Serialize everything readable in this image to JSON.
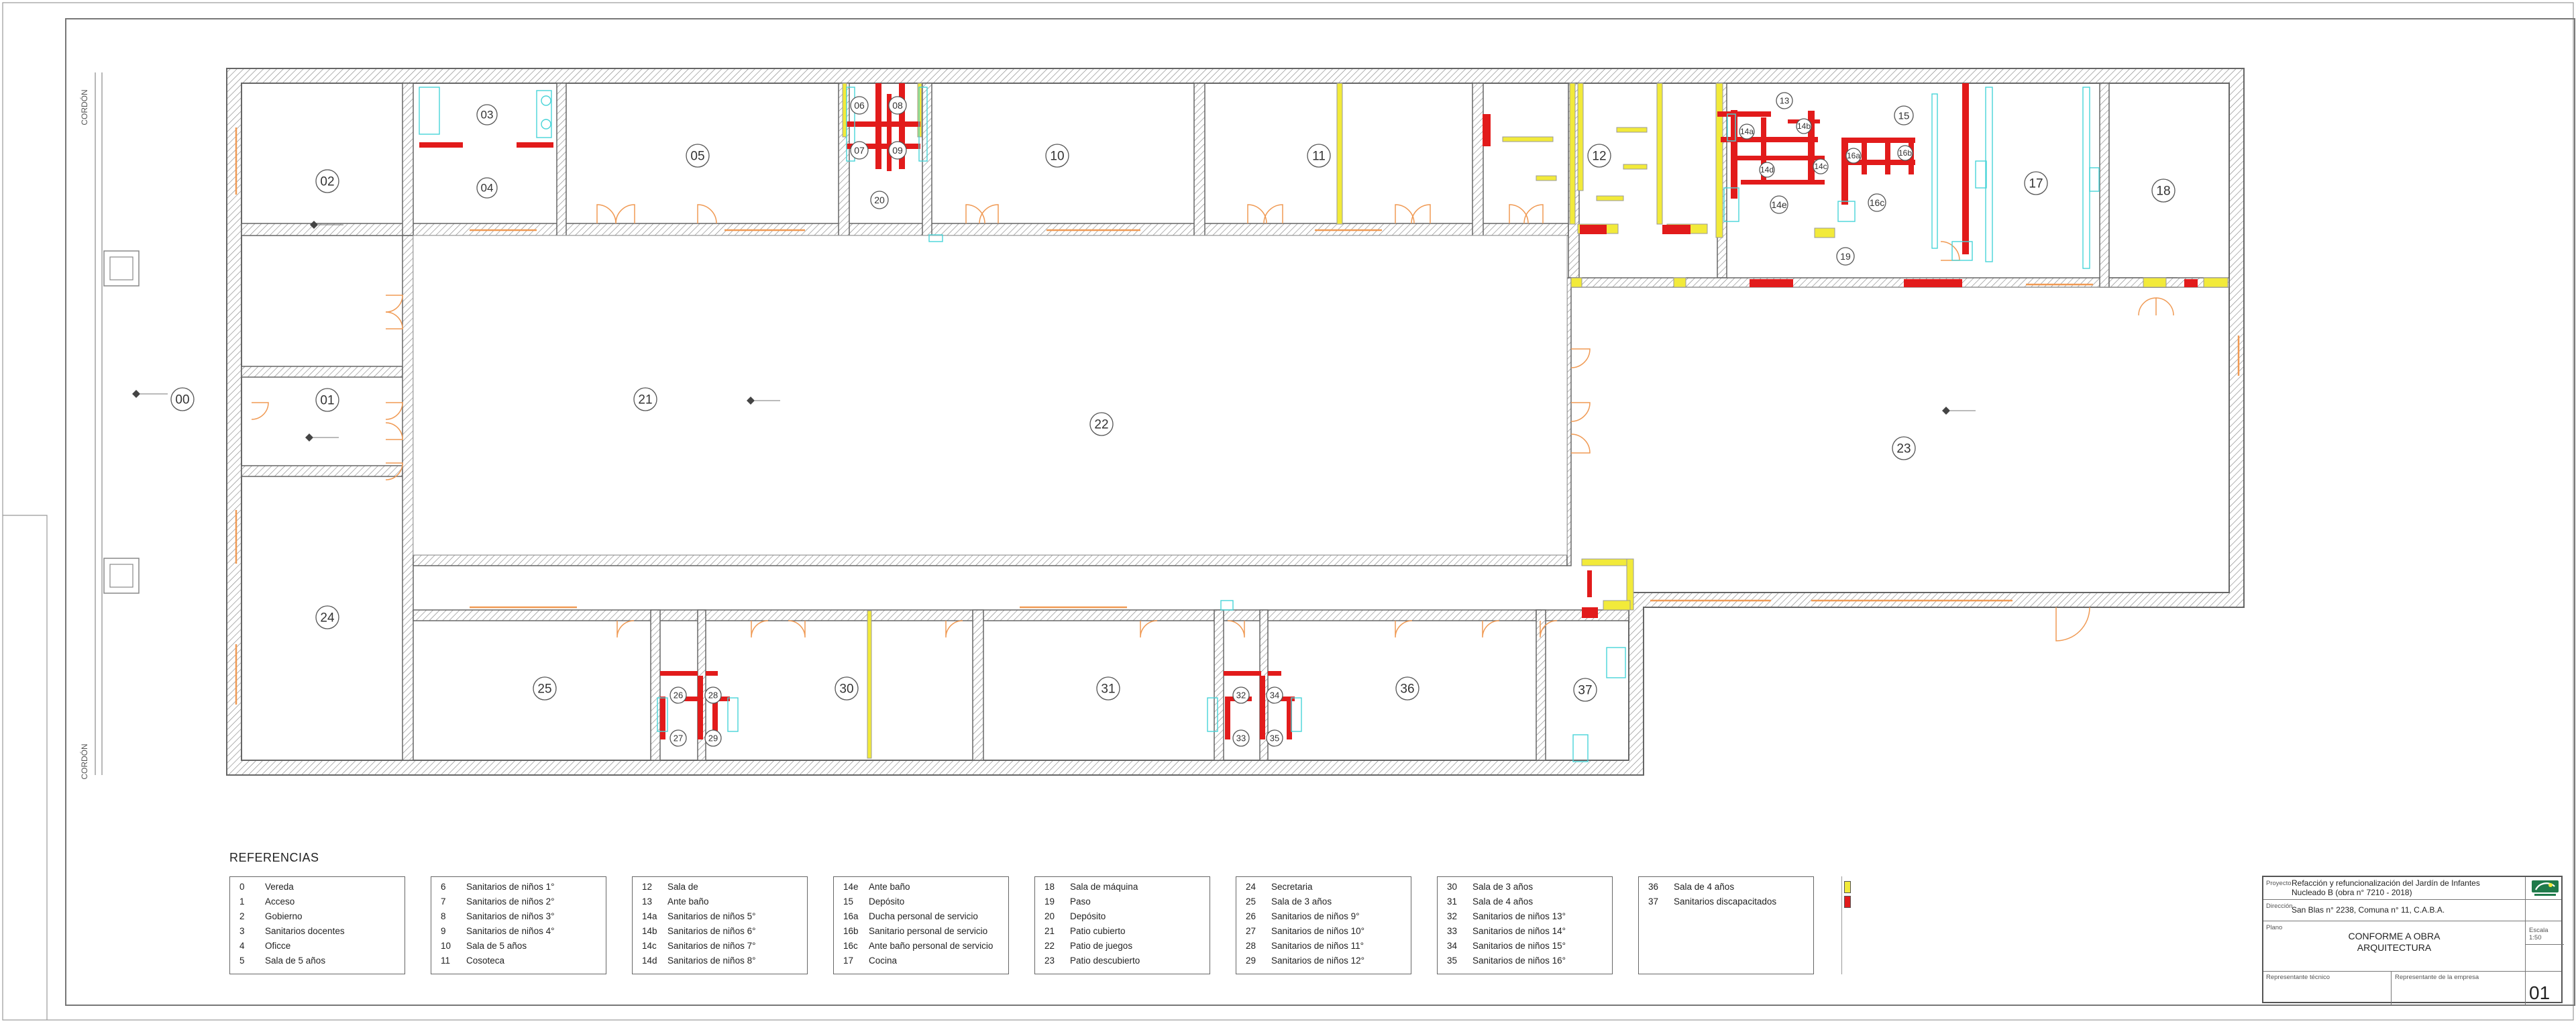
{
  "side_labels": {
    "top": "CORDÓN",
    "bottom": "CORDÓN"
  },
  "rooms": [
    {
      "id": "00",
      "label": "00"
    },
    {
      "id": "01",
      "label": "01"
    },
    {
      "id": "02",
      "label": "02"
    },
    {
      "id": "03",
      "label": "03"
    },
    {
      "id": "04",
      "label": "04"
    },
    {
      "id": "05",
      "label": "05"
    },
    {
      "id": "06",
      "label": "06"
    },
    {
      "id": "07",
      "label": "07"
    },
    {
      "id": "08",
      "label": "08"
    },
    {
      "id": "09",
      "label": "09"
    },
    {
      "id": "10",
      "label": "10"
    },
    {
      "id": "11",
      "label": "11"
    },
    {
      "id": "12",
      "label": "12"
    },
    {
      "id": "13",
      "label": "13"
    },
    {
      "id": "14a",
      "label": "14a"
    },
    {
      "id": "14b",
      "label": "14b"
    },
    {
      "id": "14c",
      "label": "14c"
    },
    {
      "id": "14d",
      "label": "14d"
    },
    {
      "id": "14e",
      "label": "14e"
    },
    {
      "id": "15",
      "label": "15"
    },
    {
      "id": "16a",
      "label": "16a"
    },
    {
      "id": "16b",
      "label": "16b"
    },
    {
      "id": "16c",
      "label": "16c"
    },
    {
      "id": "17",
      "label": "17"
    },
    {
      "id": "18",
      "label": "18"
    },
    {
      "id": "19",
      "label": "19"
    },
    {
      "id": "20",
      "label": "20"
    },
    {
      "id": "21",
      "label": "21"
    },
    {
      "id": "22",
      "label": "22"
    },
    {
      "id": "23",
      "label": "23"
    },
    {
      "id": "24",
      "label": "24"
    },
    {
      "id": "25",
      "label": "25"
    },
    {
      "id": "26",
      "label": "26"
    },
    {
      "id": "27",
      "label": "27"
    },
    {
      "id": "28",
      "label": "28"
    },
    {
      "id": "29",
      "label": "29"
    },
    {
      "id": "30",
      "label": "30"
    },
    {
      "id": "31",
      "label": "31"
    },
    {
      "id": "32",
      "label": "32"
    },
    {
      "id": "33",
      "label": "33"
    },
    {
      "id": "34",
      "label": "34"
    },
    {
      "id": "35",
      "label": "35"
    },
    {
      "id": "36",
      "label": "36"
    },
    {
      "id": "37",
      "label": "37"
    }
  ],
  "references": {
    "title": "REFERENCIAS",
    "columns": [
      [
        [
          "0",
          "Vereda"
        ],
        [
          "1",
          "Acceso"
        ],
        [
          "2",
          "Gobierno"
        ],
        [
          "3",
          "Sanitarios docentes"
        ],
        [
          "4",
          "Oficce"
        ],
        [
          "5",
          "Sala de 5 años"
        ]
      ],
      [
        [
          "6",
          "Sanitarios de niños 1°"
        ],
        [
          "7",
          "Sanitarios de niños 2°"
        ],
        [
          "8",
          "Sanitarios de niños 3°"
        ],
        [
          "9",
          "Sanitarios de niños 4°"
        ],
        [
          "10",
          "Sala de 5 años"
        ],
        [
          "11",
          "Cosoteca"
        ]
      ],
      [
        [
          "12",
          "Sala de"
        ],
        [
          "13",
          "Ante baño"
        ],
        [
          "14a",
          "Sanitarios de niños 5°"
        ],
        [
          "14b",
          "Sanitarios de niños 6°"
        ],
        [
          "14c",
          "Sanitarios de niños 7°"
        ],
        [
          "14d",
          "Sanitarios de niños 8°"
        ]
      ],
      [
        [
          "14e",
          "Ante baño"
        ],
        [
          "15",
          "Depósito"
        ],
        [
          "16a",
          "Ducha personal de servicio"
        ],
        [
          "16b",
          "Sanitario personal de servicio"
        ],
        [
          "16c",
          "Ante baño personal de servicio"
        ],
        [
          "17",
          "Cocina"
        ]
      ],
      [
        [
          "18",
          "Sala de máquina"
        ],
        [
          "19",
          "Paso"
        ],
        [
          "20",
          "Depósito"
        ],
        [
          "21",
          "Patio cubierto"
        ],
        [
          "22",
          "Patio de juegos"
        ],
        [
          "23",
          "Patio descubierto"
        ]
      ],
      [
        [
          "24",
          "Secretaria"
        ],
        [
          "25",
          "Sala de 3 años"
        ],
        [
          "26",
          "Sanitarios de niños 9°"
        ],
        [
          "27",
          "Sanitarios de niños 10°"
        ],
        [
          "28",
          "Sanitarios de niños 11°"
        ],
        [
          "29",
          "Sanitarios de niños 12°"
        ]
      ],
      [
        [
          "30",
          "Sala de 3 años"
        ],
        [
          "31",
          "Sala de 4 años"
        ],
        [
          "32",
          "Sanitarios de niños 13°"
        ],
        [
          "33",
          "Sanitarios de niños 14°"
        ],
        [
          "34",
          "Sanitarios de niños 15°"
        ],
        [
          "35",
          "Sanitarios de niños 16°"
        ]
      ],
      [
        [
          "36",
          "Sala de 4 años"
        ],
        [
          "37",
          "Sanitarios discapacitados"
        ]
      ]
    ]
  },
  "legend_colors": {
    "yellow": "#f2ea3a",
    "red": "#e21b1b"
  },
  "colors": {
    "wall": "#777777",
    "door": "#f09a54",
    "fixture": "#48d4d8"
  },
  "title_block": {
    "proyecto_label": "Proyecto",
    "proyecto_line1": "Refacción y refuncionalización del Jardín de Infantes",
    "proyecto_line2": "Nucleado B (obra n° 7210 - 2018)",
    "direccion_label": "Dirección",
    "direccion": "San Blas n° 2238, Comuna n° 11, C.A.B.A.",
    "escala": "Escala 1:50",
    "plano_label": "Plano",
    "plano_line1": "CONFORME A OBRA",
    "plano_line2": "ARQUITECTURA",
    "rep_tecnico_label": "Representante técnico",
    "rep_empresa_label": "Representante de la empresa",
    "sheet_number": "01"
  }
}
